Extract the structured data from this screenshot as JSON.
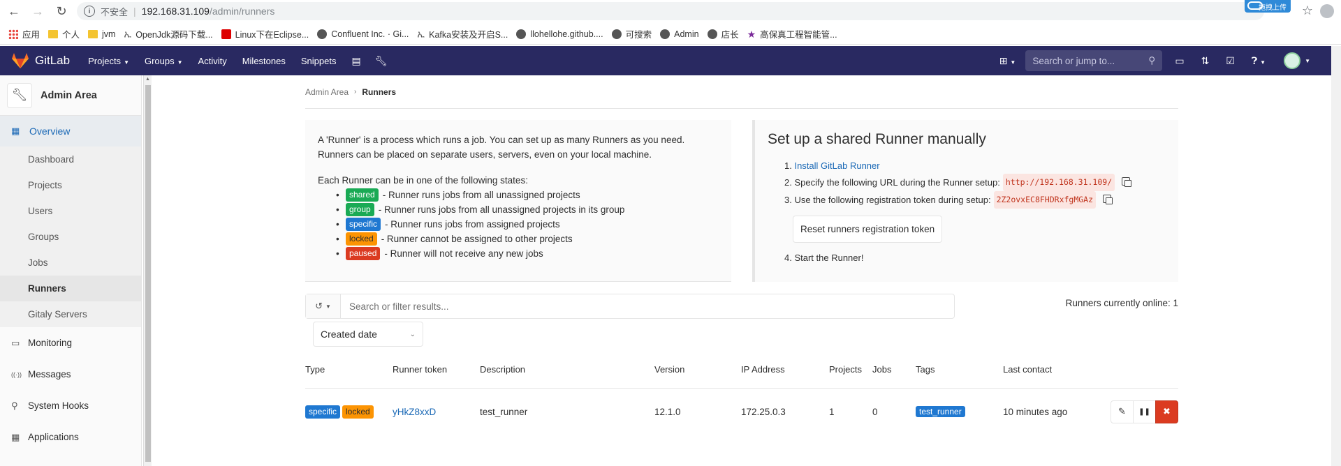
{
  "browser": {
    "insecure_label": "不安全",
    "url_host": "192.168.31.109",
    "url_path": "/admin/runners",
    "ext_label": "拖拽上传"
  },
  "bookmarks": [
    {
      "label": "应用",
      "icon": "apps-icon"
    },
    {
      "label": "个人",
      "icon": "folder-icon"
    },
    {
      "label": "jvm",
      "icon": "folder-icon"
    },
    {
      "label": "OpenJdk源码下载...",
      "icon": "leaf-icon"
    },
    {
      "label": "Linux下在Eclipse...",
      "icon": "red-square-icon"
    },
    {
      "label": "Confluent Inc. · Gi...",
      "icon": "github-icon"
    },
    {
      "label": "Kafka安装及开启S...",
      "icon": "leaf-icon"
    },
    {
      "label": "llohellohe.github....",
      "icon": "github-icon"
    },
    {
      "label": "可搜索",
      "icon": "globe-icon"
    },
    {
      "label": "Admin",
      "icon": "globe-icon"
    },
    {
      "label": "店长",
      "icon": "globe-icon"
    },
    {
      "label": "高保真工程智能管...",
      "icon": "star-icon"
    }
  ],
  "header": {
    "brand": "GitLab",
    "nav": [
      {
        "label": "Projects",
        "dropdown": true
      },
      {
        "label": "Groups",
        "dropdown": true
      },
      {
        "label": "Activity",
        "dropdown": false
      },
      {
        "label": "Milestones",
        "dropdown": false
      },
      {
        "label": "Snippets",
        "dropdown": false
      }
    ],
    "search_placeholder": "Search or jump to..."
  },
  "sidebar": {
    "title": "Admin Area",
    "overview": "Overview",
    "overview_items": [
      "Dashboard",
      "Projects",
      "Users",
      "Groups",
      "Jobs",
      "Runners",
      "Gitaly Servers"
    ],
    "active_item": "Runners",
    "other_items": [
      {
        "label": "Monitoring",
        "icon": "monitor-icon"
      },
      {
        "label": "Messages",
        "icon": "broadcast-icon"
      },
      {
        "label": "System Hooks",
        "icon": "hook-icon"
      },
      {
        "label": "Applications",
        "icon": "grid-icon"
      }
    ]
  },
  "breadcrumb": {
    "parent": "Admin Area",
    "current": "Runners"
  },
  "intro": {
    "p1": "A 'Runner' is a process which runs a job. You can set up as many Runners as you need. Runners can be placed on separate users, servers, even on your local machine.",
    "p2": "Each Runner can be in one of the following states:",
    "states": [
      {
        "badge": "shared",
        "text": "- Runner runs jobs from all unassigned projects",
        "color": "#1aaa55"
      },
      {
        "badge": "group",
        "text": "- Runner runs jobs from all unassigned projects in its group",
        "color": "#1aaa55"
      },
      {
        "badge": "specific",
        "text": "- Runner runs jobs from assigned projects",
        "color": "#1f78d1"
      },
      {
        "badge": "locked",
        "text": "- Runner cannot be assigned to other projects",
        "color": "#fc9403"
      },
      {
        "badge": "paused",
        "text": "- Runner will not receive any new jobs",
        "color": "#db3b21"
      }
    ]
  },
  "setup": {
    "title": "Set up a shared Runner manually",
    "step1_prefix": "1. ",
    "step1_link": "Install GitLab Runner",
    "step2": "2. Specify the following URL during the Runner setup:",
    "url": "http://192.168.31.109/",
    "step3": "3. Use the following registration token during setup:",
    "token": "2Z2ovxEC8FHDRxfgMGAz",
    "reset_button": "Reset runners registration token",
    "step4": "4. Start the Runner!"
  },
  "filter": {
    "placeholder": "Search or filter results...",
    "online": "Runners currently online: 1",
    "sort": "Created date"
  },
  "table": {
    "headers": [
      "Type",
      "Runner token",
      "Description",
      "Version",
      "IP Address",
      "Projects",
      "Jobs",
      "Tags",
      "Last contact"
    ],
    "rows": [
      {
        "badges": [
          "specific",
          "locked"
        ],
        "token": "yHkZ8xxD",
        "description": "test_runner",
        "version": "12.1.0",
        "ip": "172.25.0.3",
        "projects": "1",
        "jobs": "0",
        "tag": "test_runner",
        "last_contact": "10 minutes ago"
      }
    ]
  }
}
